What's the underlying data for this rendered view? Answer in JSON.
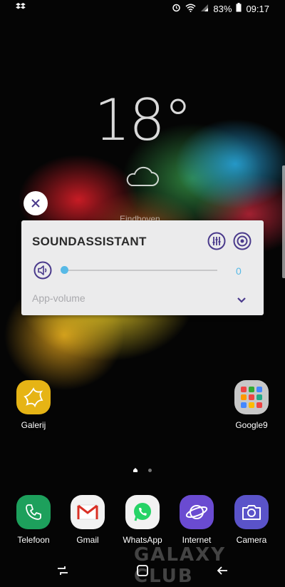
{
  "status_bar": {
    "battery": "83%",
    "time": "09:17"
  },
  "clock_widget": {
    "temperature": "18°",
    "place": "Eindhoven"
  },
  "sound_assistant": {
    "title": "SOUNDASSISTANT",
    "volume_value": "0",
    "volume_level": 0,
    "app_volume_label": "App-volume",
    "accent_color": "#57b9e6",
    "icon_color": "#4a3a8c"
  },
  "home_apps": [
    {
      "label": "Galerij",
      "icon": "gallery-icon"
    },
    {
      "label": "Google9",
      "icon": "folder-icon"
    }
  ],
  "dock": [
    {
      "label": "Telefoon",
      "icon": "phone-icon"
    },
    {
      "label": "Gmail",
      "icon": "gmail-icon"
    },
    {
      "label": "WhatsApp",
      "icon": "whatsapp-icon"
    },
    {
      "label": "Internet",
      "icon": "internet-icon"
    },
    {
      "label": "Camera",
      "icon": "camera-icon"
    }
  ],
  "watermark": "GALAXY CLUB"
}
